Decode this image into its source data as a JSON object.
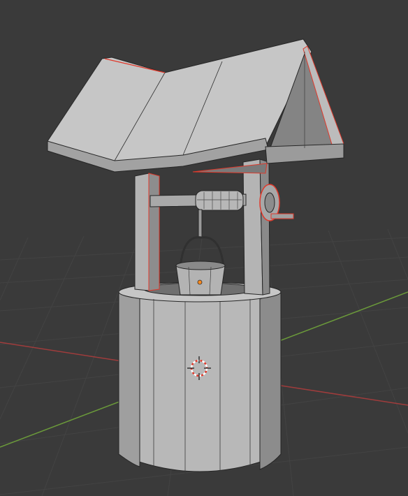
{
  "viewport": {
    "name": "3D Viewport",
    "colors": {
      "background": "#3a3a3a",
      "grid_line": "#434343",
      "x_axis": "#a03c3c",
      "y_axis": "#6b9a3a",
      "mesh_face": "#b9b9b9",
      "mesh_edge": "#202020",
      "selection_outline": "#e0392b",
      "origin_dot": "#ff8a1e"
    }
  },
  "scene": {
    "object": "wishing-well-mesh",
    "parts": [
      "roof",
      "gable-end",
      "left-post",
      "right-post",
      "crossbar",
      "rope-drum",
      "crank-wheel",
      "crank-handle",
      "rope",
      "bucket-handle",
      "bucket",
      "well-base"
    ],
    "3d-cursor": "3d-cursor-icon"
  }
}
